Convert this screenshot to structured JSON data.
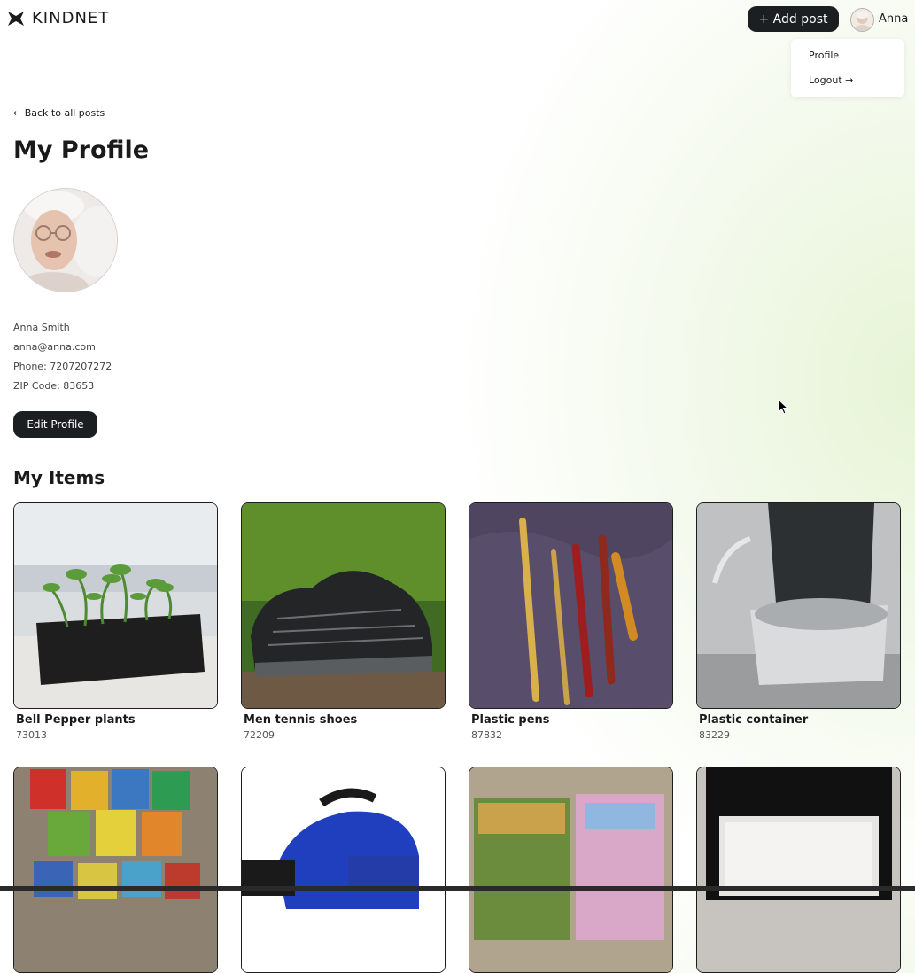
{
  "header": {
    "logo_text": "KINDNET",
    "add_post_label": "+ Add post",
    "user_name": "Anna"
  },
  "user_menu": {
    "items": [
      {
        "label": "Profile"
      },
      {
        "label": "Logout →"
      }
    ]
  },
  "page": {
    "back_link": "← Back to all posts",
    "title": "My Profile"
  },
  "profile": {
    "name": "Anna Smith",
    "email": "anna@anna.com",
    "phone": "Phone: 7207207272",
    "zip": "ZIP Code: 83653",
    "edit_label": "Edit Profile"
  },
  "items": {
    "title": "My Items",
    "cards": [
      {
        "title": "Bell Pepper plants",
        "zip": "73013"
      },
      {
        "title": "Men tennis shoes",
        "zip": "72209"
      },
      {
        "title": "Plastic pens",
        "zip": "87832"
      },
      {
        "title": "Plastic container",
        "zip": "83229"
      },
      {
        "title": "",
        "zip": ""
      },
      {
        "title": "",
        "zip": ""
      },
      {
        "title": "",
        "zip": ""
      },
      {
        "title": "",
        "zip": ""
      }
    ]
  },
  "colors": {
    "primary_dark": "#1c1f22",
    "accent_green": "#e7f4d6"
  }
}
